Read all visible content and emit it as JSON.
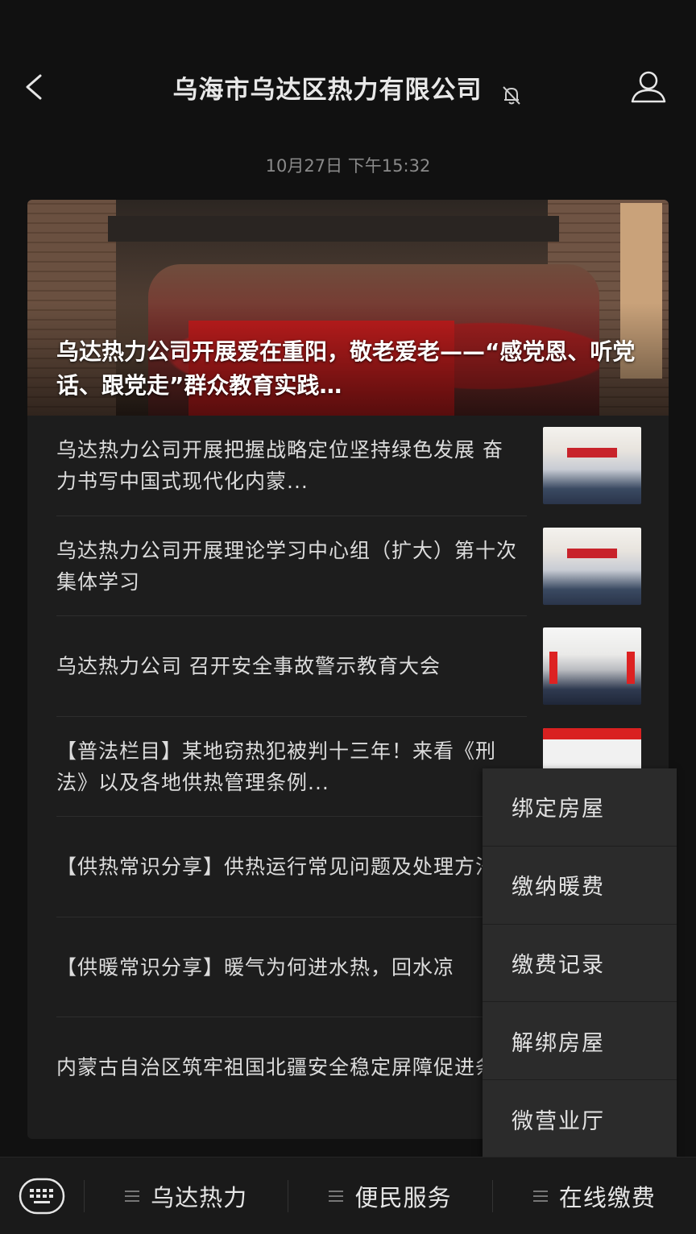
{
  "header": {
    "title": "乌海市乌达区热力有限公司",
    "mute_icon": "bell-off-icon",
    "profile_icon": "person-icon",
    "back_icon": "chevron-left-icon"
  },
  "timestamp": "10月27日 下午15:32",
  "hero": {
    "title": "乌达热力公司开展爱在重阳，敬老爱老——“感党恩、听党话、跟党走”群众教育实践…"
  },
  "articles": [
    {
      "title": "乌达热力公司开展把握战略定位坚持绿色发展 奋力书写中国式现代化内蒙..."
    },
    {
      "title": "乌达热力公司开展理论学习中心组（扩大）第十次集体学习"
    },
    {
      "title": "乌达热力公司 召开安全事故警示教育大会"
    },
    {
      "title": "【普法栏目】某地窃热犯被判十三年！来看《刑法》以及各地供热管理条例..."
    },
    {
      "title": "【供热常识分享】供热运行常见问题及处理方法"
    },
    {
      "title": "【供暖常识分享】暖气为何进水热，回水凉"
    },
    {
      "title": "内蒙古自治区筑牢祖国北疆安全稳定屏障促进条例"
    }
  ],
  "popup_menu": {
    "items": [
      "绑定房屋",
      "缴纳暖费",
      "缴费记录",
      "解绑房屋",
      "微营业厅"
    ]
  },
  "bottom_menu": {
    "keyboard_icon": "keyboard-icon",
    "tabs": [
      "乌达热力",
      "便民服务",
      "在线缴费"
    ]
  }
}
